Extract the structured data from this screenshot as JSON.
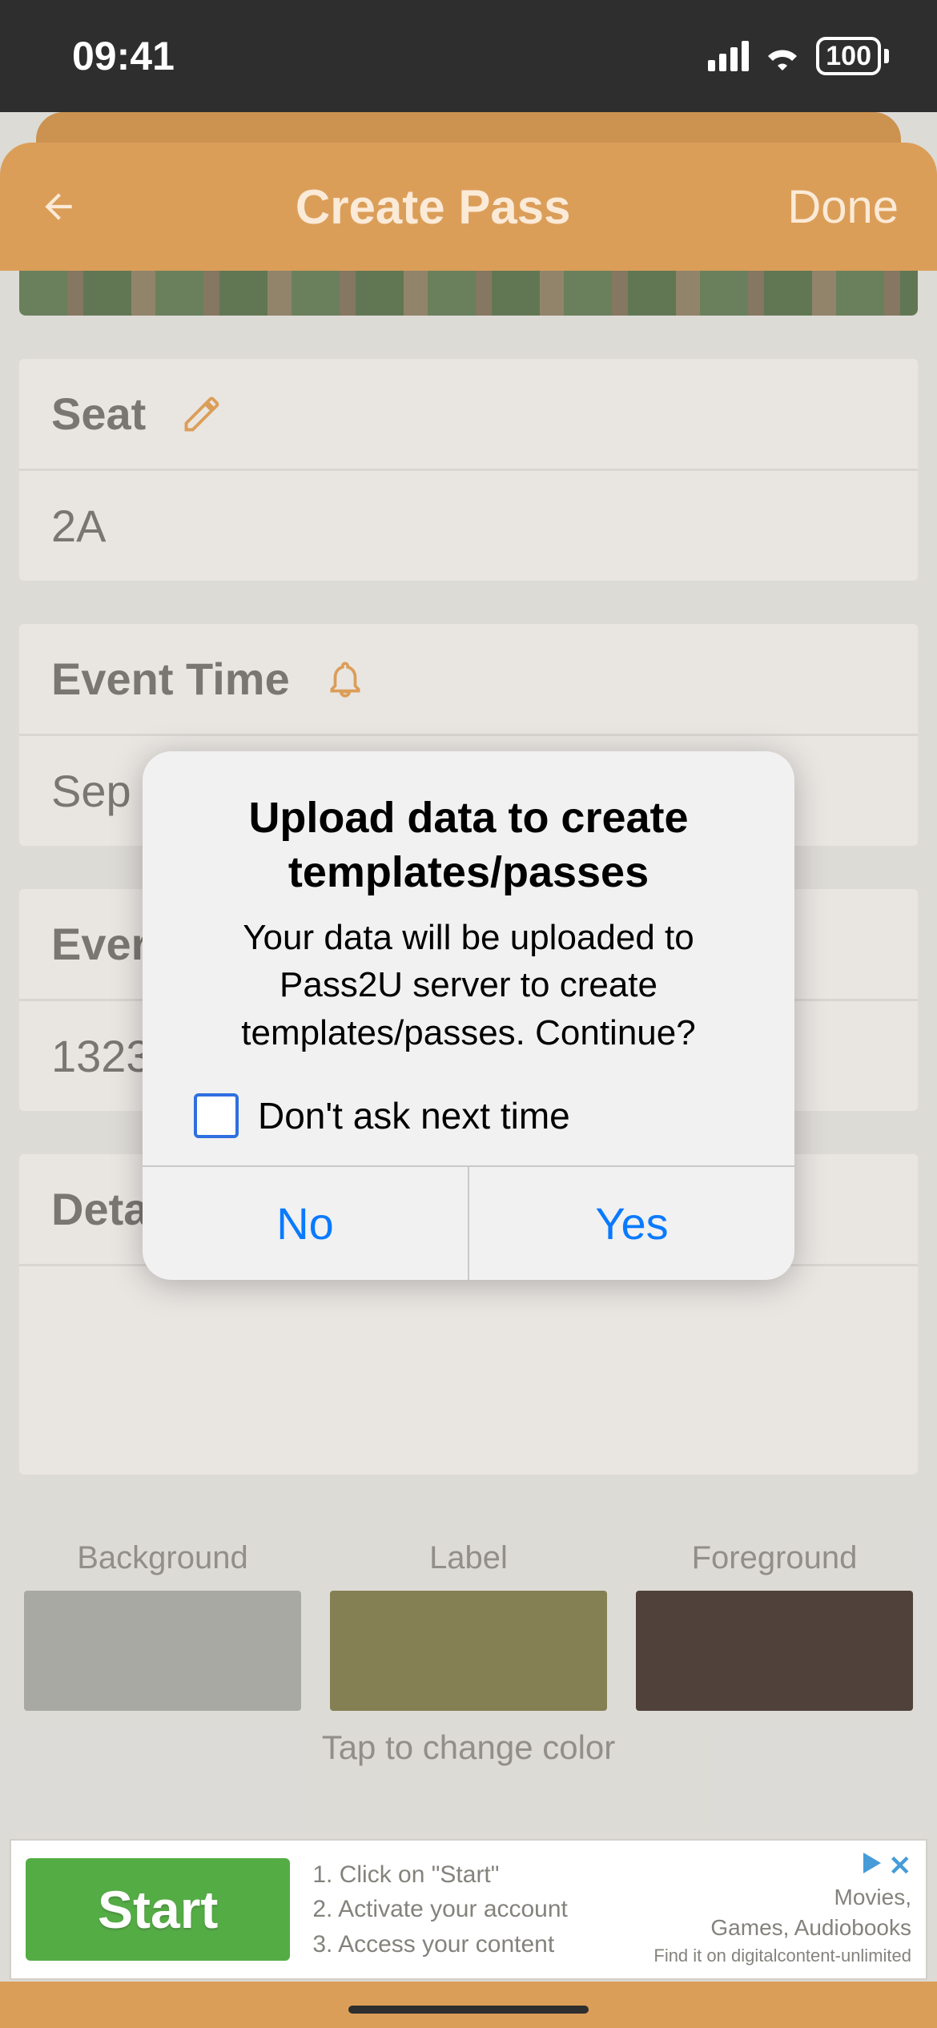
{
  "status": {
    "time": "09:41",
    "battery": "100"
  },
  "header": {
    "title": "Create Pass",
    "done": "Done"
  },
  "seat": {
    "label": "Seat",
    "value": "2A"
  },
  "event_time": {
    "label": "Event Time",
    "value": "Sep "
  },
  "event_code": {
    "label": "Ever",
    "value": "1323"
  },
  "details": {
    "label": "Deta"
  },
  "colors": {
    "background": "Background",
    "label": "Label",
    "foreground": "Foreground",
    "hint": "Tap to change color"
  },
  "ad": {
    "start": "Start",
    "line1": "1. Click on \"Start\"",
    "line2": "2. Activate your account",
    "line3": "3. Access your content",
    "tag1": "Movies,",
    "tag2": "Games, Audiobooks",
    "fine": "Find it on digitalcontent-unlimited"
  },
  "modal": {
    "title": "Upload data to create templates/passes",
    "message": "Your data will be uploaded to Pass2U server to create templates/passes. Continue?",
    "checkbox": "Don't ask next time",
    "no": "No",
    "yes": "Yes"
  }
}
